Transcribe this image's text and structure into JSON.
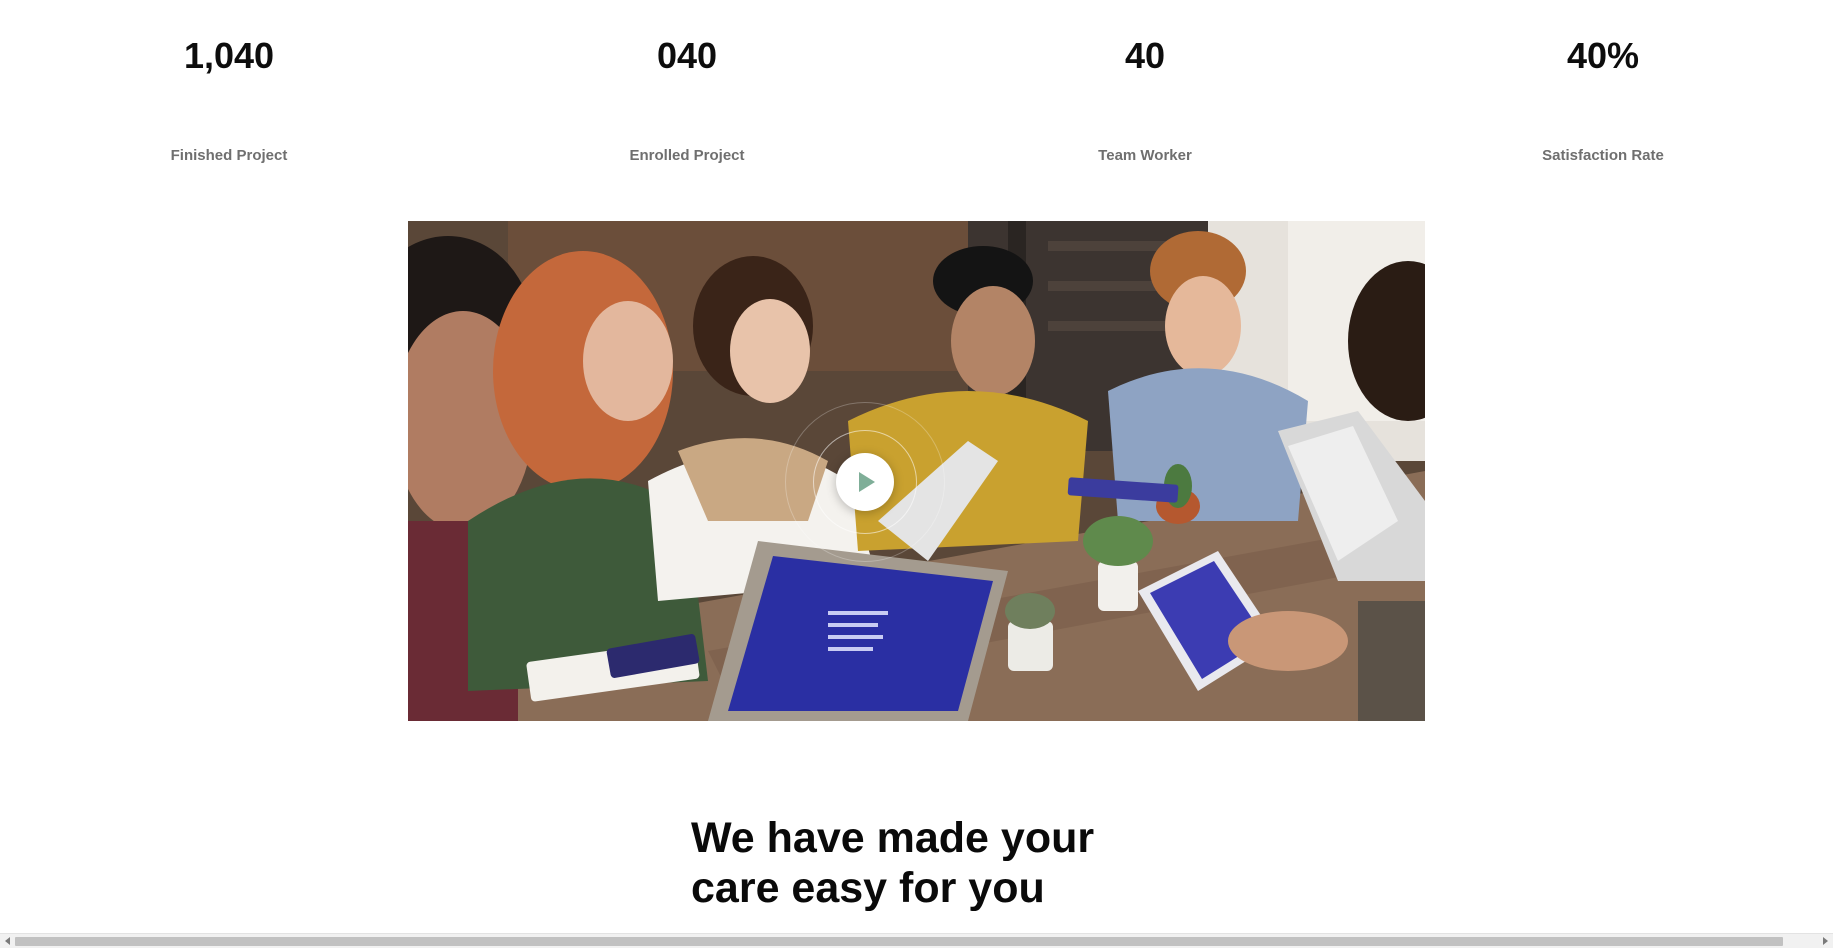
{
  "stats": [
    {
      "value": "1,040",
      "label": "Finished Project"
    },
    {
      "value": "040",
      "label": "Enrolled Project"
    },
    {
      "value": "40",
      "label": "Team Worker"
    },
    {
      "value": "40%",
      "label": "Satisfaction Rate"
    }
  ],
  "video": {
    "image": "team-meeting-photo",
    "play_icon": "play-icon",
    "play_color": "#7fae98"
  },
  "section": {
    "heading_line_1": "We have made your",
    "heading_line_2": "care easy for you"
  },
  "colors": {
    "stat_number": "#0d0d0d",
    "stat_label": "#6f6f6f",
    "heading": "#0a0a0a"
  }
}
